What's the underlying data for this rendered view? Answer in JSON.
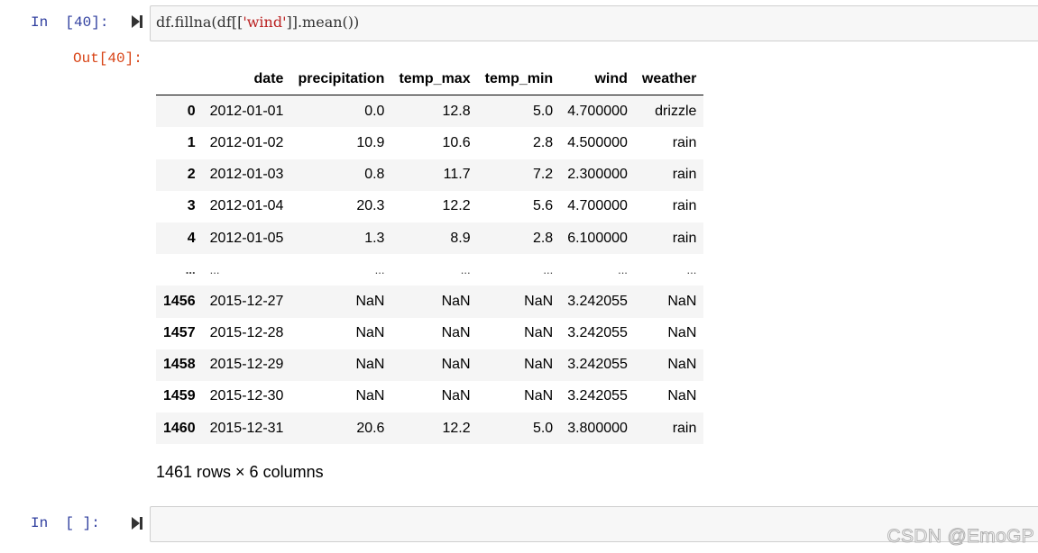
{
  "cell1": {
    "prompt": "In  [40]:",
    "code_pre": "df.fillna(df[[",
    "code_str": "'wind'",
    "code_post": "]].mean())",
    "run_icon": "run-step-icon"
  },
  "output": {
    "prompt": "Out[40]:",
    "columns": [
      "",
      "date",
      "precipitation",
      "temp_max",
      "temp_min",
      "wind",
      "weather"
    ],
    "rows": [
      {
        "index": "0",
        "date": "2012-01-01",
        "precipitation": "0.0",
        "temp_max": "12.8",
        "temp_min": "5.0",
        "wind": "4.700000",
        "weather": "drizzle"
      },
      {
        "index": "1",
        "date": "2012-01-02",
        "precipitation": "10.9",
        "temp_max": "10.6",
        "temp_min": "2.8",
        "wind": "4.500000",
        "weather": "rain"
      },
      {
        "index": "2",
        "date": "2012-01-03",
        "precipitation": "0.8",
        "temp_max": "11.7",
        "temp_min": "7.2",
        "wind": "2.300000",
        "weather": "rain"
      },
      {
        "index": "3",
        "date": "2012-01-04",
        "precipitation": "20.3",
        "temp_max": "12.2",
        "temp_min": "5.6",
        "wind": "4.700000",
        "weather": "rain"
      },
      {
        "index": "4",
        "date": "2012-01-05",
        "precipitation": "1.3",
        "temp_max": "8.9",
        "temp_min": "2.8",
        "wind": "6.100000",
        "weather": "rain"
      },
      {
        "index": "...",
        "date": "...",
        "precipitation": "...",
        "temp_max": "...",
        "temp_min": "...",
        "wind": "...",
        "weather": "..."
      },
      {
        "index": "1456",
        "date": "2015-12-27",
        "precipitation": "NaN",
        "temp_max": "NaN",
        "temp_min": "NaN",
        "wind": "3.242055",
        "weather": "NaN"
      },
      {
        "index": "1457",
        "date": "2015-12-28",
        "precipitation": "NaN",
        "temp_max": "NaN",
        "temp_min": "NaN",
        "wind": "3.242055",
        "weather": "NaN"
      },
      {
        "index": "1458",
        "date": "2015-12-29",
        "precipitation": "NaN",
        "temp_max": "NaN",
        "temp_min": "NaN",
        "wind": "3.242055",
        "weather": "NaN"
      },
      {
        "index": "1459",
        "date": "2015-12-30",
        "precipitation": "NaN",
        "temp_max": "NaN",
        "temp_min": "NaN",
        "wind": "3.242055",
        "weather": "NaN"
      },
      {
        "index": "1460",
        "date": "2015-12-31",
        "precipitation": "20.6",
        "temp_max": "12.2",
        "temp_min": "5.0",
        "wind": "3.800000",
        "weather": "rain"
      }
    ],
    "row_count": "1461 rows × 6 columns"
  },
  "cell2": {
    "prompt": "In  [ ]:",
    "code": ""
  },
  "watermark": "CSDN @EmoGP",
  "colors": {
    "in_prompt": "#303f9f",
    "out_prompt": "#d84315",
    "string": "#ba2121",
    "code_bg": "#f7f7f7"
  }
}
